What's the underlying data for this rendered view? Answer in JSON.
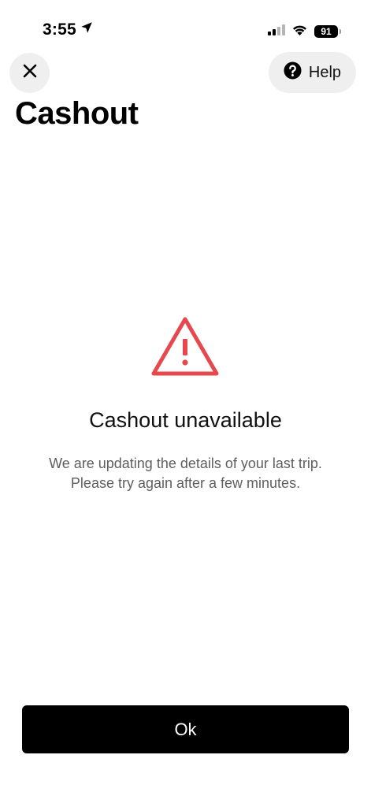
{
  "status_bar": {
    "time": "3:55",
    "battery": "91",
    "icons": [
      "location-arrow-icon",
      "cellular-signal-icon",
      "wifi-icon",
      "battery-icon"
    ]
  },
  "header": {
    "close_icon": "close-icon",
    "help_label": "Help",
    "help_icon": "question-circle-icon"
  },
  "page": {
    "title": "Cashout"
  },
  "error": {
    "icon": "warning-triangle-icon",
    "icon_color": "#e5484d",
    "title": "Cashout unavailable",
    "message": "We are updating the details of your last trip.\nPlease try again after a few minutes."
  },
  "footer": {
    "ok_label": "Ok"
  }
}
